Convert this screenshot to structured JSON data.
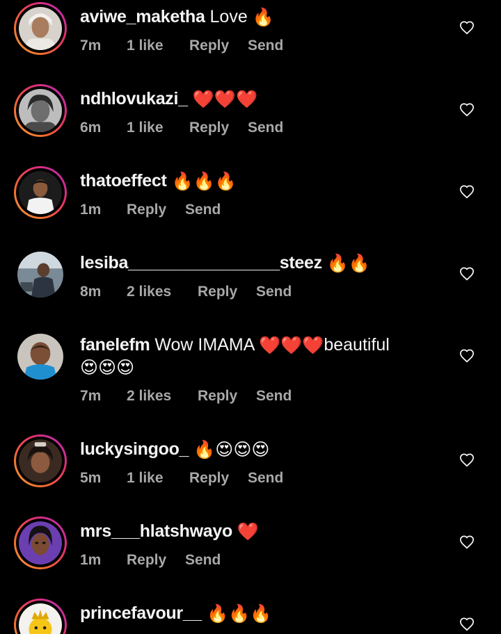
{
  "comments": [
    {
      "username": "aviwe_maketha",
      "text": "Love",
      "emojis": "🔥",
      "time": "7m",
      "likes": "1 like",
      "reply": "Reply",
      "send": "Send"
    },
    {
      "username": "ndhlovukazi_",
      "text": "",
      "emojis": "❤️❤️❤️",
      "time": "6m",
      "likes": "1 like",
      "reply": "Reply",
      "send": "Send"
    },
    {
      "username": "thatoeffect",
      "text": "",
      "emojis": "🔥🔥🔥",
      "time": "1m",
      "reply": "Reply",
      "send": "Send"
    },
    {
      "username": "lesiba________________steez",
      "text": "",
      "emojis": "🔥🔥",
      "time": "8m",
      "likes": "2 likes",
      "reply": "Reply",
      "send": "Send"
    },
    {
      "username": "fanelefm",
      "text": "Wow IMAMA",
      "emojis": "❤️❤️❤️",
      "text2": "beautiful",
      "emojis2": "😍😍😍",
      "time": "7m",
      "likes": "2 likes",
      "reply": "Reply",
      "send": "Send"
    },
    {
      "username": "luckysingoo_",
      "text": "",
      "emojis": "🔥😍😍😍",
      "time": "5m",
      "likes": "1 like",
      "reply": "Reply",
      "send": "Send"
    },
    {
      "username": "mrs___hlatshwayo",
      "text": "",
      "emojis": "❤️",
      "time": "1m",
      "reply": "Reply",
      "send": "Send"
    },
    {
      "username": "princefavour__",
      "text": "",
      "emojis": "🔥🔥🔥"
    }
  ],
  "colors": {
    "background": "#000000",
    "text": "#f5f5f5",
    "meta": "#a8a8a8",
    "story_ring": "#e1306c"
  },
  "icons": {
    "like": "heart-outline-icon"
  }
}
